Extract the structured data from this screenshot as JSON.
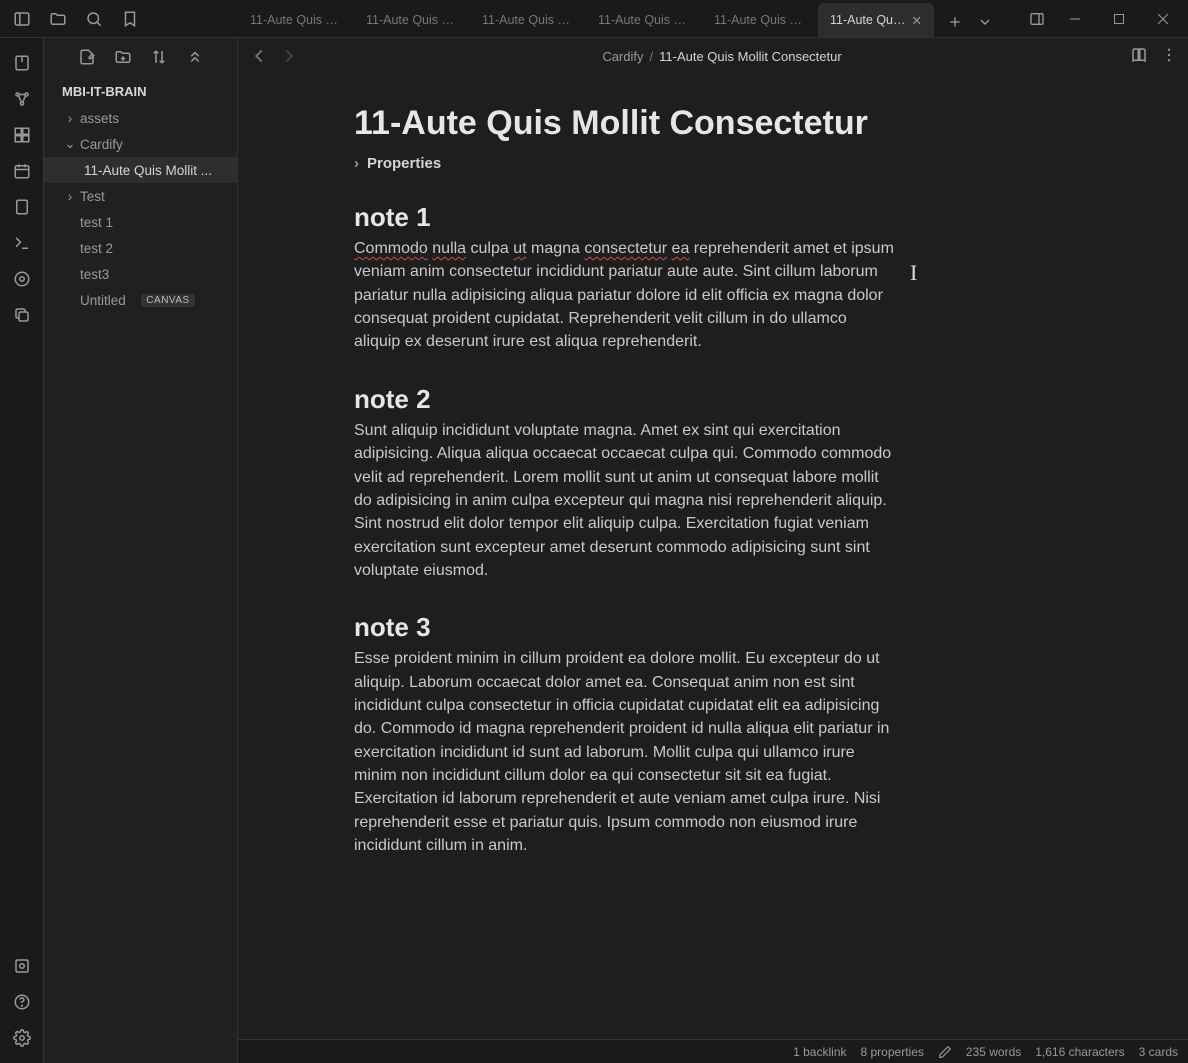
{
  "titlebar": {
    "tabs": [
      {
        "label": "11-Aute Quis M...",
        "active": false
      },
      {
        "label": "11-Aute Quis M...",
        "active": false
      },
      {
        "label": "11-Aute Quis M...",
        "active": false
      },
      {
        "label": "11-Aute Quis M...",
        "active": false
      },
      {
        "label": "11-Aute Quis M...",
        "active": false
      },
      {
        "label": "11-Aute Qui...",
        "active": true
      }
    ]
  },
  "vault": "MBI-IT-BRAIN",
  "tree": {
    "items": [
      {
        "label": "assets",
        "type": "folder",
        "expanded": false,
        "depth": 1
      },
      {
        "label": "Cardify",
        "type": "folder",
        "expanded": true,
        "depth": 1
      },
      {
        "label": "11-Aute Quis Mollit ...",
        "type": "file",
        "depth": 2,
        "active": true
      },
      {
        "label": "Test",
        "type": "folder",
        "expanded": false,
        "depth": 1
      },
      {
        "label": "test 1",
        "type": "file",
        "depth": 1
      },
      {
        "label": "test 2",
        "type": "file",
        "depth": 1
      },
      {
        "label": "test3",
        "type": "file",
        "depth": 1
      },
      {
        "label": "Untitled",
        "type": "canvas",
        "depth": 1,
        "badge": "CANVAS"
      }
    ]
  },
  "breadcrumb": {
    "parent": "Cardify",
    "current": "11-Aute Quis Mollit Consectetur"
  },
  "note": {
    "title": "11-Aute Quis Mollit Consectetur",
    "properties_label": "Properties",
    "sections": [
      {
        "heading": "note 1",
        "spelled_line_pre": "Commodo ",
        "spelled_line_mid1": "nulla",
        "spelled_line_gap1": " culpa ",
        "spelled_line_mid2": "ut",
        "spelled_line_gap2": " magna ",
        "spelled_line_mid3": "consectetur",
        "spelled_line_gap3": " ",
        "spelled_line_mid4": "ea",
        "body": "reprehenderit amet et ipsum veniam anim consectetur incididunt pariatur aute aute. Sint cillum laborum pariatur nulla adipisicing aliqua pariatur dolore id elit officia ex magna dolor consequat proident cupidatat. Reprehenderit velit cillum in do ullamco aliquip ex deserunt irure est aliqua reprehenderit."
      },
      {
        "heading": "note 2",
        "body": "Sunt aliquip incididunt voluptate magna. Amet ex sint qui exercitation adipisicing. Aliqua aliqua occaecat occaecat culpa qui. Commodo commodo velit ad reprehenderit. Lorem mollit sunt ut anim ut consequat labore mollit do adipisicing in anim culpa excepteur qui magna nisi reprehenderit aliquip. Sint nostrud elit dolor tempor elit aliquip culpa. Exercitation fugiat veniam exercitation sunt excepteur amet deserunt commodo adipisicing sunt sint voluptate eiusmod."
      },
      {
        "heading": "note 3",
        "body": "Esse proident minim in cillum proident ea dolore mollit. Eu excepteur do ut aliquip. Laborum occaecat dolor amet ea. Consequat anim non est sint incididunt culpa consectetur in officia cupidatat cupidatat elit ea adipisicing do. Commodo id magna reprehenderit proident id nulla aliqua elit pariatur in exercitation incididunt id sunt ad laborum. Mollit culpa qui ullamco irure minim non incididunt cillum dolor ea qui consectetur sit sit ea fugiat. Exercitation id laborum reprehenderit et aute veniam amet culpa irure. Nisi reprehenderit esse et pariatur quis. Ipsum commodo non eiusmod irure incididunt cillum in anim."
      }
    ]
  },
  "status": {
    "backlinks": "1 backlink",
    "properties": "8 properties",
    "words": "235 words",
    "chars": "1,616 characters",
    "cards": "3 cards"
  }
}
